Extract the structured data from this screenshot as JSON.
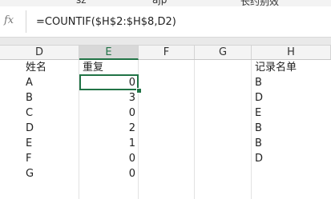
{
  "top_fragments": [
    "sz",
    "ajp",
    "长约别效"
  ],
  "formula_bar": {
    "fx_label": "fx",
    "formula": "=COUNTIF($H$2:$H$8,D2)"
  },
  "columns": [
    {
      "letter": "D",
      "selected": false
    },
    {
      "letter": "E",
      "selected": true
    },
    {
      "letter": "F",
      "selected": false
    },
    {
      "letter": "G",
      "selected": false
    },
    {
      "letter": "H",
      "selected": false
    }
  ],
  "header_row": {
    "D": "姓名",
    "E": "重复",
    "H": "记录名单"
  },
  "rows": [
    {
      "D": "A",
      "E": "0",
      "H": "B"
    },
    {
      "D": "B",
      "E": "3",
      "H": "D"
    },
    {
      "D": "C",
      "E": "0",
      "H": "E"
    },
    {
      "D": "D",
      "E": "2",
      "H": "B"
    },
    {
      "D": "E",
      "E": "1",
      "H": "B"
    },
    {
      "D": "F",
      "E": "0",
      "H": "D"
    },
    {
      "D": "G",
      "E": "0",
      "H": ""
    }
  ],
  "colors": {
    "accent": "#217346"
  }
}
